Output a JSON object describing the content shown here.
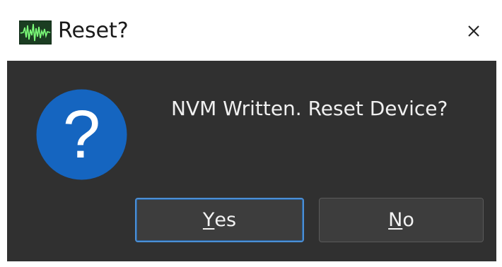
{
  "window": {
    "title": "Reset?",
    "app_icon": "waveform-monitor-icon",
    "close_icon": "close-icon"
  },
  "dialog": {
    "icon": "question-icon",
    "message": "NVM Written. Reset Device?",
    "buttons": {
      "yes": {
        "mnemonic": "Y",
        "rest": "es"
      },
      "no": {
        "mnemonic": "N",
        "rest": "o"
      }
    }
  },
  "colors": {
    "body_bg": "#303030",
    "question_icon": "#1565c0",
    "default_button_border": "#4b8fd6"
  }
}
